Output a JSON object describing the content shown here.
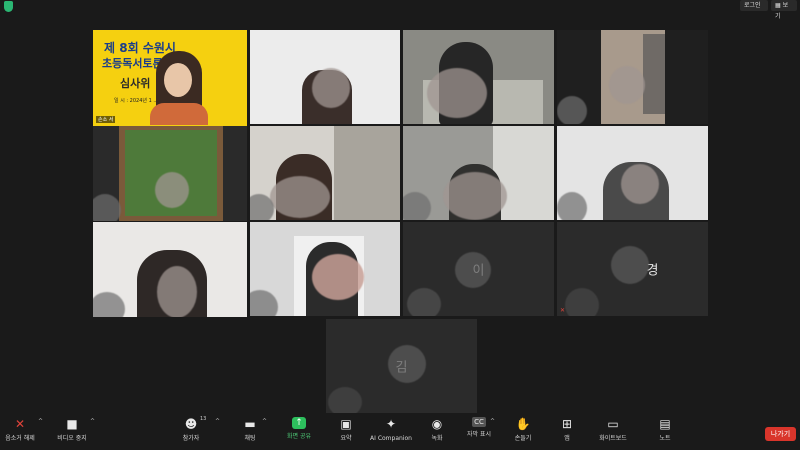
{
  "topbar": {
    "login_label": "로그인",
    "view_label": "보기"
  },
  "tiles": [
    {
      "id": "t1",
      "kind": "poster",
      "poster_line1": "제 8회 수원시",
      "poster_line2": "초등독서토론대회",
      "poster_line3": "심사위",
      "poster_line4": "일 시 : 2024년 1 ... 20분",
      "name_tag": "손소 서"
    },
    {
      "id": "t2",
      "kind": "video"
    },
    {
      "id": "t3",
      "kind": "video"
    },
    {
      "id": "t4",
      "kind": "video"
    },
    {
      "id": "t5",
      "kind": "video"
    },
    {
      "id": "t6",
      "kind": "video"
    },
    {
      "id": "t7",
      "kind": "video"
    },
    {
      "id": "t8",
      "kind": "video"
    },
    {
      "id": "t9",
      "kind": "video"
    },
    {
      "id": "t10",
      "kind": "video"
    },
    {
      "id": "t11",
      "kind": "name",
      "name": "이"
    },
    {
      "id": "t12",
      "kind": "name",
      "name": "경"
    },
    {
      "id": "t13",
      "kind": "name",
      "name": "김"
    }
  ],
  "toolbar": {
    "mute": {
      "label": "음소거 해제",
      "icon": "mic-muted-icon"
    },
    "video": {
      "label": "비디오 중지",
      "icon": "video-camera-icon"
    },
    "participants": {
      "label": "참가자",
      "count": "13",
      "icon": "participants-icon"
    },
    "chat": {
      "label": "채팅",
      "icon": "chat-icon"
    },
    "share": {
      "label": "화면 공유",
      "icon": "share-screen-icon"
    },
    "summary": {
      "label": "요약",
      "icon": "summary-icon"
    },
    "ai": {
      "label": "AI Companion",
      "icon": "ai-companion-icon"
    },
    "record": {
      "label": "녹화",
      "icon": "record-icon"
    },
    "captions": {
      "label": "자막 표시",
      "icon": "captions-icon"
    },
    "raise_hand": {
      "label": "손들기",
      "icon": "raise-hand-icon"
    },
    "apps": {
      "label": "앱",
      "icon": "apps-icon"
    },
    "whiteboard": {
      "label": "화이트보드",
      "icon": "whiteboard-icon"
    },
    "notes": {
      "label": "노트",
      "icon": "notes-icon"
    },
    "leave": {
      "label": "나가기"
    }
  },
  "colors": {
    "background": "#1a1a1a",
    "share_green": "#2dbf5d",
    "leave_red": "#d9352b",
    "poster_yellow": "#f5d010"
  }
}
